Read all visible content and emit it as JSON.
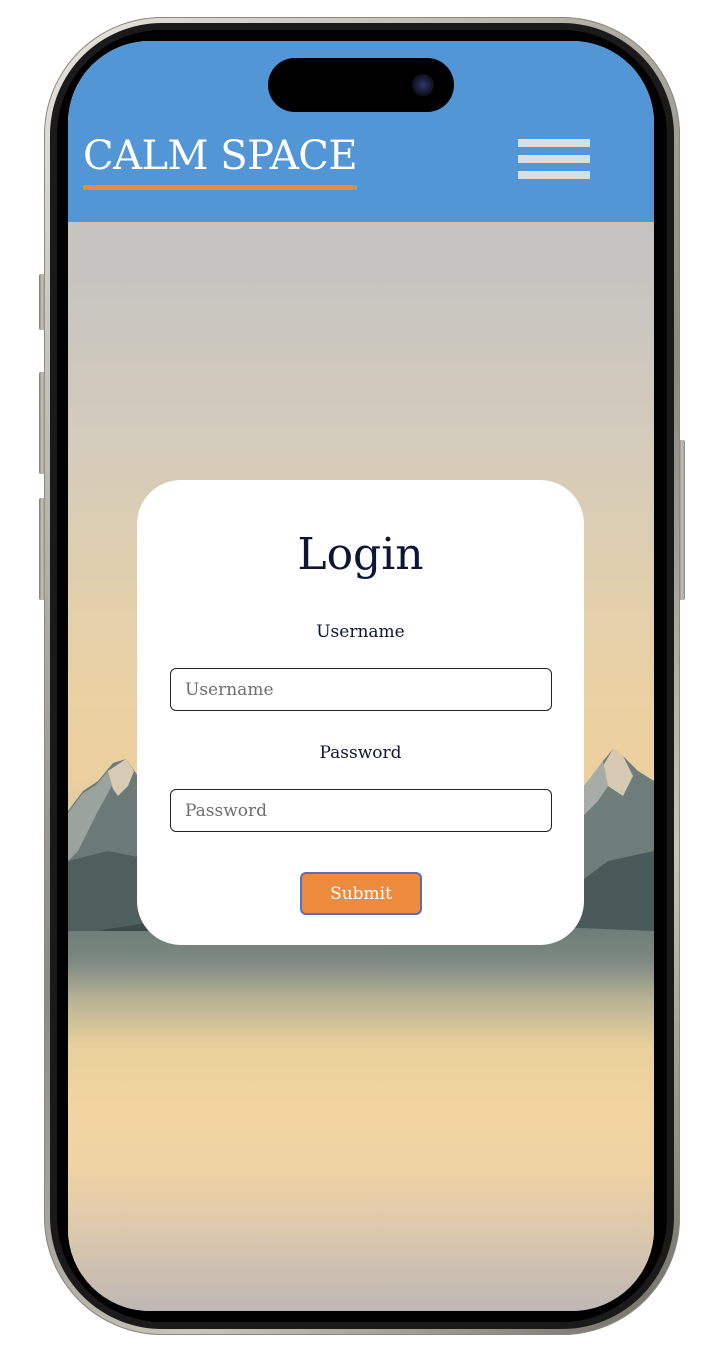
{
  "header": {
    "brand": "CALM SPACE",
    "menu_icon": "hamburger-menu-icon",
    "background_color": "#5396d6",
    "brand_underline_color": "#ea8a3c"
  },
  "login": {
    "title": "Login",
    "username_label": "Username",
    "username_placeholder": "Username",
    "username_value": "",
    "password_label": "Password",
    "password_placeholder": "Password",
    "password_value": "",
    "submit_label": "Submit",
    "submit_color": "#ec8b3d"
  }
}
